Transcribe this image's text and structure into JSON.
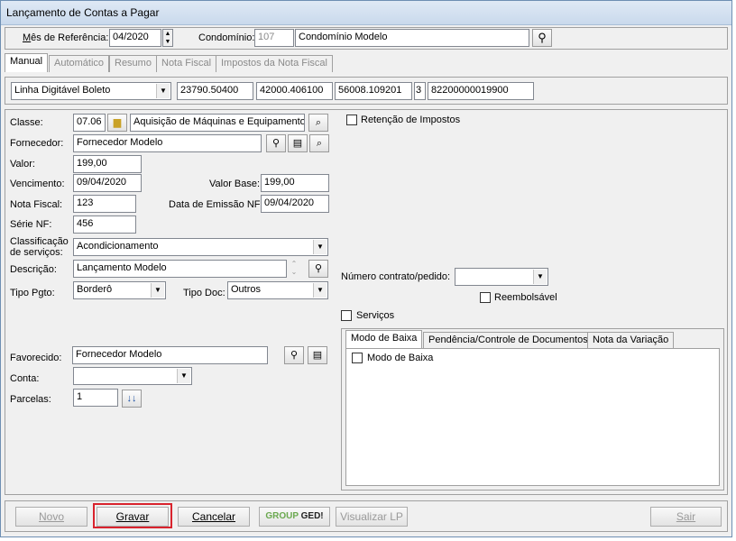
{
  "window": {
    "title": "Lançamento de Contas a Pagar"
  },
  "header": {
    "mes_label": "Mês de Referência:",
    "mes_value": "04/2020",
    "condominio_label": "Condomínio:",
    "condominio_code": "107",
    "condominio_name": "Condomínio Modelo"
  },
  "tabs": [
    "Manual",
    "Automático",
    "Resumo",
    "Nota Fiscal",
    "Impostos da Nota Fiscal"
  ],
  "barcode": {
    "type": "Linha Digitável Boleto",
    "fields": [
      "23790.50400",
      "42000.406100",
      "56008.109201",
      "3",
      "82200000019900"
    ]
  },
  "form": {
    "classe_label": "Classe:",
    "classe_code": "07.06",
    "classe_desc": "Aquisição de Máquinas e Equipamentos",
    "fornecedor_label": "Fornecedor:",
    "fornecedor_value": "Fornecedor Modelo",
    "valor_label": "Valor:",
    "valor_value": "199,00",
    "vencimento_label": "Vencimento:",
    "vencimento_value": "09/04/2020",
    "valor_base_label": "Valor Base:",
    "valor_base_value": "199,00",
    "nota_label": "Nota Fiscal:",
    "nota_value": "123",
    "data_emissao_label": "Data de Emissão NF:",
    "data_emissao_value": "09/04/2020",
    "serie_label": "Série NF:",
    "serie_value": "456",
    "classificacao_label_1": "Classificação",
    "classificacao_label_2": "de serviços:",
    "classificacao_value": "Acondicionamento",
    "descricao_label": "Descrição:",
    "descricao_value": "Lançamento Modelo",
    "tipo_pgto_label": "Tipo Pgto:",
    "tipo_pgto_value": "Borderô",
    "tipo_doc_label": "Tipo Doc:",
    "tipo_doc_value": "Outros",
    "favorecido_label": "Favorecido:",
    "favorecido_value": "Fornecedor Modelo",
    "conta_label": "Conta:",
    "conta_value": "",
    "parcelas_label": "Parcelas:",
    "parcelas_value": "1"
  },
  "right": {
    "retencao_label": "Retenção de Impostos",
    "numero_contrato_label": "Número contrato/pedido:",
    "reembolsavel_label": "Reembolsável",
    "servicos_label": "Serviços",
    "subtabs": [
      "Modo de Baixa",
      "Pendência/Controle de Documentos",
      "Nota da Variação"
    ],
    "modo_baixa_label": "Modo de Baixa"
  },
  "buttons": {
    "novo": "Novo",
    "gravar": "Gravar",
    "cancelar": "Cancelar",
    "ged_group": "GROUP",
    "ged_ged": "GED!",
    "visualizar": "Visualizar LP",
    "sair": "Sair"
  },
  "colors": {
    "highlight": "#d9232d",
    "title_bar": "#c9d9ec"
  }
}
